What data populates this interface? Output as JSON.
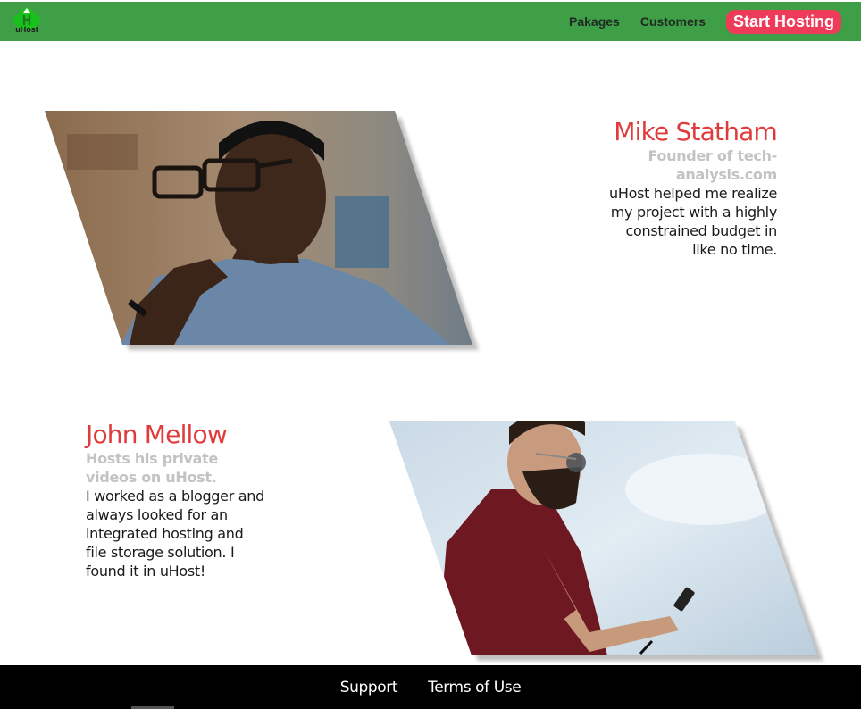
{
  "header": {
    "logo_text": "uHost",
    "nav": [
      {
        "label": "Pakages"
      },
      {
        "label": "Customers"
      }
    ],
    "cta_label": "Start Hosting"
  },
  "testimonials": [
    {
      "name": "Mike Statham",
      "role": "Founder of tech-analysis.com",
      "quote": "uHost helped me realize my project with a highly constrained budget in like no time."
    },
    {
      "name": "John Mellow",
      "role": "Hosts his private videos on uHost.",
      "quote": "I worked as a blogger and always looked for an integrated hosting and file storage solution. I found it in uHost!"
    }
  ],
  "footer": {
    "links": [
      {
        "label": "Support"
      },
      {
        "label": "Terms of Use"
      }
    ]
  },
  "colors": {
    "header_bg": "#3f9f47",
    "cta_bg": "#ef3b5a",
    "name": "#e03a3a",
    "role": "#c3c3c3",
    "footer_bg": "#000000"
  }
}
